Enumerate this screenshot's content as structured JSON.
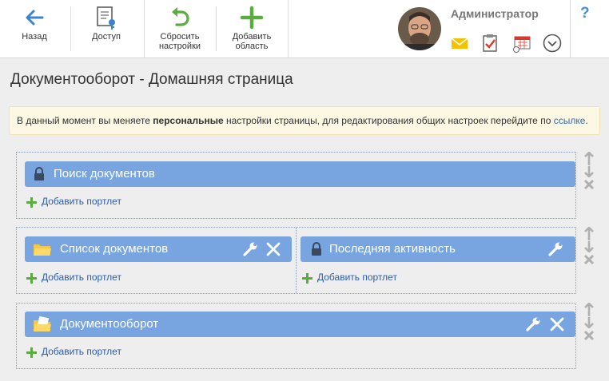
{
  "toolbar": {
    "back": "Назад",
    "access": "Доступ",
    "reset": "Сбросить настройки",
    "add_area": "Добавить область"
  },
  "user": {
    "name": "Администратор"
  },
  "help": "?",
  "page": {
    "title": "Документооборот - Домашняя страница"
  },
  "notice": {
    "prefix": "В данный момент вы меняете ",
    "bold": "персональные",
    "middle": " настройки страницы, для редактирования общих настроек перейдите по ",
    "link": "ссылке",
    "suffix": "."
  },
  "zones": [
    {
      "portlets": [
        {
          "title": "Поиск документов",
          "icon": "lock-icon"
        }
      ]
    },
    {
      "portlets": [
        {
          "title": "Список документов",
          "icon": "folder-icon"
        },
        {
          "title": "Последняя активность",
          "icon": "lock-icon"
        }
      ]
    },
    {
      "portlets": [
        {
          "title": "Документооборот",
          "icon": "folder-doc-icon"
        }
      ]
    }
  ],
  "add_portlet": "Добавить портлет",
  "colors": {
    "accent": "#78a5e0",
    "toolbar_icon_blue": "#3d84d0",
    "toolbar_icon_green": "#5aac3e",
    "link": "#2a5db0",
    "notice_bg": "#fcf8e3"
  }
}
